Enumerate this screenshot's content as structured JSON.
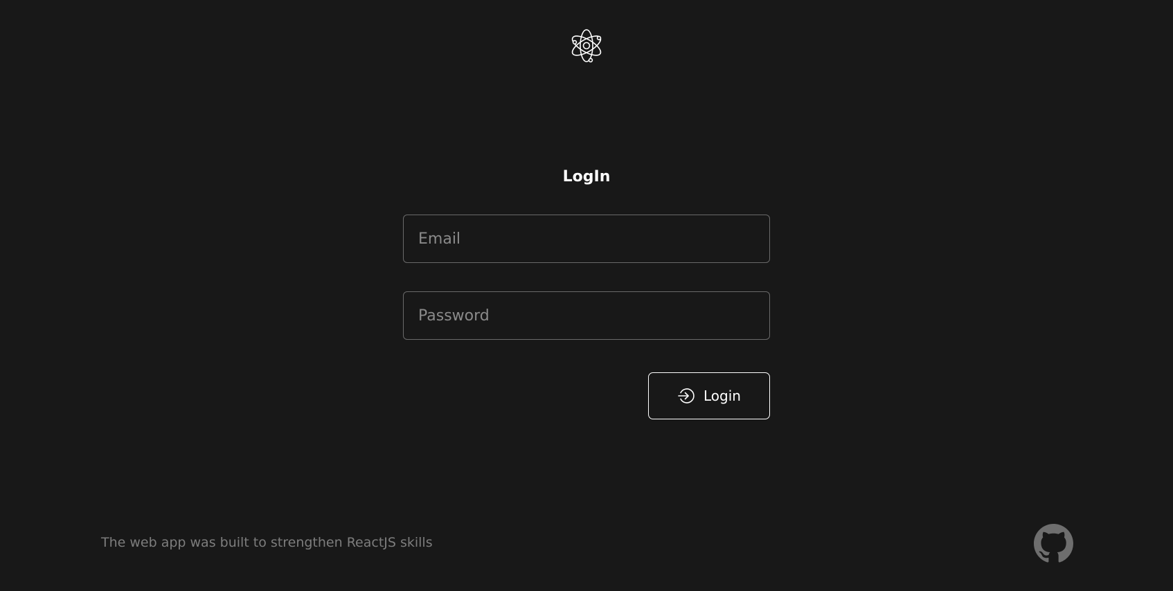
{
  "header": {
    "logo_icon": "atom-icon"
  },
  "form": {
    "title": "LogIn",
    "email": {
      "value": "",
      "placeholder": "Email"
    },
    "password": {
      "value": "",
      "placeholder": "Password"
    },
    "submit": {
      "icon": "login-arrow-icon",
      "label": "Login"
    }
  },
  "footer": {
    "text": "The web app was built to strengthen ReactJS skills",
    "github_icon": "github-icon"
  },
  "colors": {
    "background": "#181818",
    "text": "#ffffff",
    "muted_text": "#7d7d7d",
    "border": "#6a6a6a",
    "github": "#6e6e6e"
  }
}
